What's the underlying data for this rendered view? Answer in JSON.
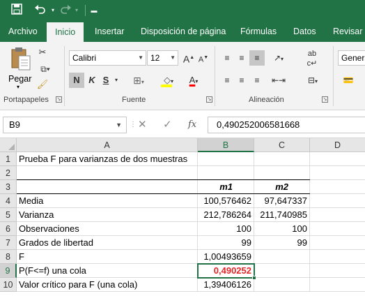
{
  "qat": {
    "save_icon": "save-icon",
    "undo_icon": "undo-icon",
    "redo_icon": "redo-icon",
    "customize_icon": "customize-qat-icon"
  },
  "tabs": [
    "Archivo",
    "Inicio",
    "Insertar",
    "Disposición de página",
    "Fórmulas",
    "Datos",
    "Revisar"
  ],
  "ribbon": {
    "clipboard": {
      "paste_label": "Pegar",
      "group_label": "Portapapeles"
    },
    "font": {
      "font_name": "Calibri",
      "font_size": "12",
      "bold": "N",
      "italic": "K",
      "underline": "S",
      "group_label": "Fuente",
      "font_color": "#ff0000",
      "highlight_color": "#ffff00"
    },
    "alignment": {
      "group_label": "Alineación"
    },
    "number": {
      "format": "Genera"
    }
  },
  "formula_bar": {
    "name_box": "B9",
    "fx": "fx",
    "value": "0,490252006581668"
  },
  "columns": [
    "A",
    "B",
    "C",
    "D"
  ],
  "rows": [
    {
      "n": "1",
      "a": "Prueba F para varianzas de dos muestras",
      "b": "",
      "c": ""
    },
    {
      "n": "2",
      "a": "",
      "b": "",
      "c": ""
    },
    {
      "n": "3",
      "a": "",
      "b": "m1",
      "c": "m2"
    },
    {
      "n": "4",
      "a": "Media",
      "b": "100,576462",
      "c": "97,647337"
    },
    {
      "n": "5",
      "a": "Varianza",
      "b": "212,786264",
      "c": "211,740985"
    },
    {
      "n": "6",
      "a": "Observaciones",
      "b": "100",
      "c": "100"
    },
    {
      "n": "7",
      "a": "Grados de libertad",
      "b": "99",
      "c": "99"
    },
    {
      "n": "8",
      "a": "F",
      "b": "1,00493659",
      "c": ""
    },
    {
      "n": "9",
      "a": "P(F<=f) una cola",
      "b": "0,490252",
      "c": ""
    },
    {
      "n": "10",
      "a": "Valor crítico para F (una cola)",
      "b": "1,39406126",
      "c": ""
    }
  ],
  "colors": {
    "accent": "#217346",
    "highlight_value": "#e32626"
  }
}
